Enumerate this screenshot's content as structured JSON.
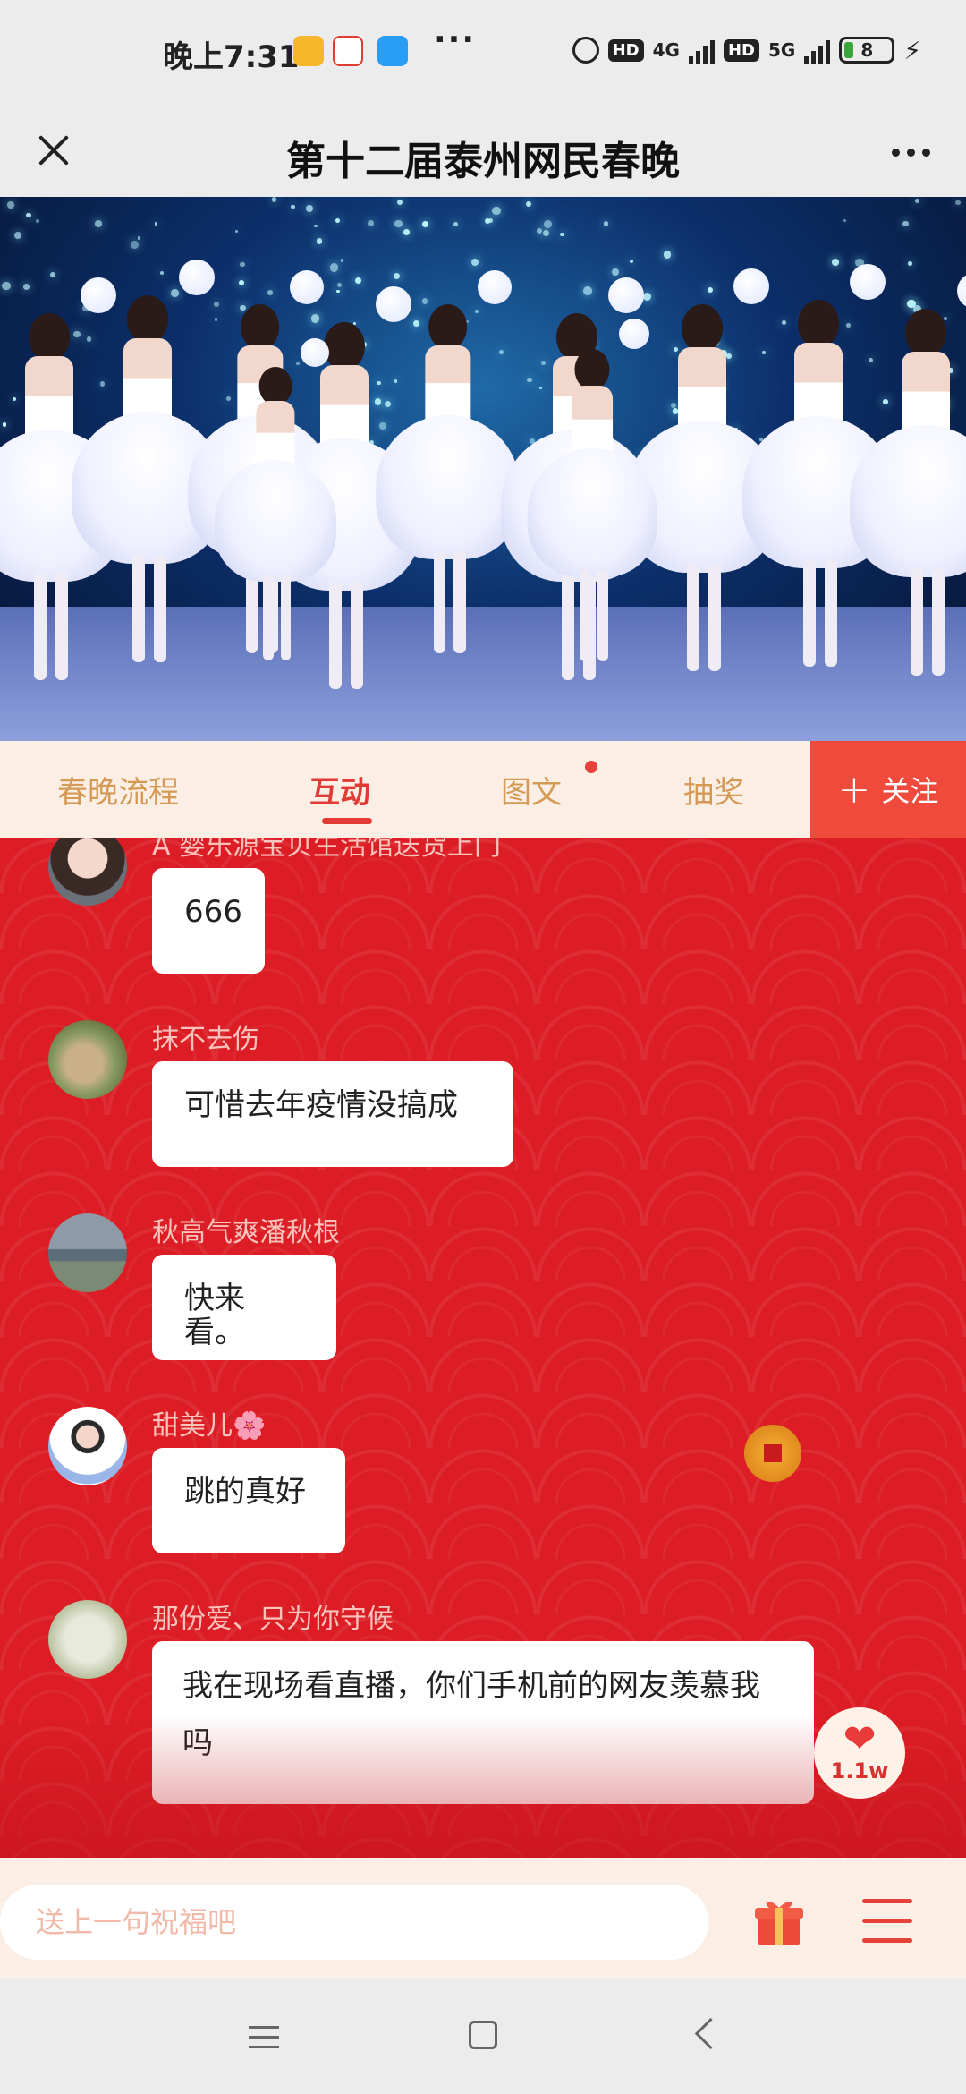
{
  "status_bar": {
    "time": "晚上7:31",
    "network_1": "4G",
    "network_2": "5G",
    "hd_label": "HD",
    "battery": "8",
    "overflow": "···"
  },
  "header": {
    "title": "第十二届泰州网民春晚"
  },
  "tabs": {
    "items": [
      "春晚流程",
      "互动",
      "图文",
      "抽奖"
    ],
    "active_index": 1,
    "follow_label": "关注"
  },
  "messages": [
    {
      "user": "A 婴乐源宝贝生活馆送货上门",
      "text": "666"
    },
    {
      "user": "抹不去伤",
      "text": "可惜去年疫情没搞成"
    },
    {
      "user": "秋高气爽潘秋根",
      "text": "快来看。"
    },
    {
      "user": "甜美儿🌸",
      "text": "跳的真好"
    },
    {
      "user": "那份爱、只为你守候",
      "text": "我在现场看直播，你们手机前的网友羡慕我吗"
    }
  ],
  "like": {
    "count": "1.1w"
  },
  "input": {
    "placeholder": "送上一句祝福吧"
  },
  "icons": {
    "close": "close-icon",
    "more": "more-icon",
    "gift": "gift-icon",
    "menu": "menu-icon",
    "heart": "heart-icon"
  },
  "colors": {
    "accent_red": "#e23a35",
    "chat_bg": "#dc1d25",
    "tab_text": "#d49a55",
    "follow_bg": "#f04a3d"
  }
}
